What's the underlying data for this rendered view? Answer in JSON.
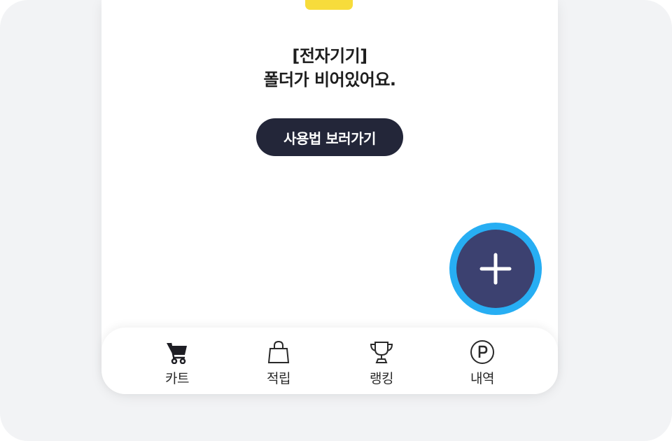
{
  "folder": {
    "title": "[전자기기]",
    "message": "폴더가 비어있어요.",
    "howto_label": "사용법 보러가기",
    "accent_color": "#f7dc3b"
  },
  "fab": {
    "icon": "plus-icon",
    "ring_color": "#27aef3",
    "fill_color": "#3c4170"
  },
  "bottom_nav": {
    "items": [
      {
        "label": "카트",
        "icon": "cart-icon",
        "active": true
      },
      {
        "label": "적립",
        "icon": "shopping-bag-icon",
        "active": false
      },
      {
        "label": "랭킹",
        "icon": "trophy-icon",
        "active": false
      },
      {
        "label": "내역",
        "icon": "points-icon",
        "active": false
      }
    ]
  }
}
